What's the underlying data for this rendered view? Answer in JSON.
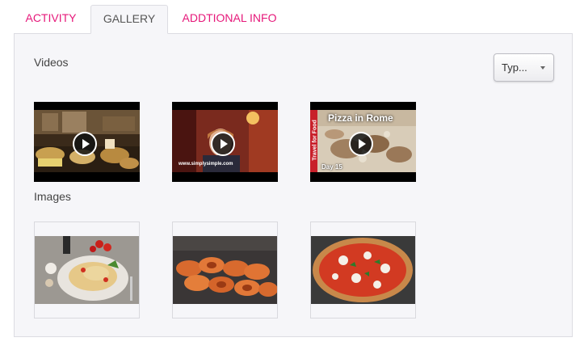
{
  "tabs": [
    {
      "label": "ACTIVITY",
      "active": false
    },
    {
      "label": "GALLERY",
      "active": true
    },
    {
      "label": "ADDTIONAL INFO",
      "active": false
    }
  ],
  "gallery": {
    "videos_title": "Videos",
    "images_title": "Images",
    "type_select": {
      "value": "Typ..."
    },
    "videos": [
      {
        "thumbnail": "market-stall"
      },
      {
        "thumbnail": "restaurant-host",
        "caption": "www.simplysimple.com"
      },
      {
        "thumbnail": "pizza-in-rome",
        "title": "Pizza in Rome",
        "side_label": "Travel for Food",
        "day_label": "Day 15"
      }
    ],
    "images": [
      {
        "thumbnail": "spaghetti-plate"
      },
      {
        "thumbnail": "rigatoni-pasta"
      },
      {
        "thumbnail": "margherita-pizza"
      }
    ]
  },
  "colors": {
    "accent": "#e6187a",
    "panel_bg": "#f6f6f9",
    "border": "#dcdce2"
  }
}
